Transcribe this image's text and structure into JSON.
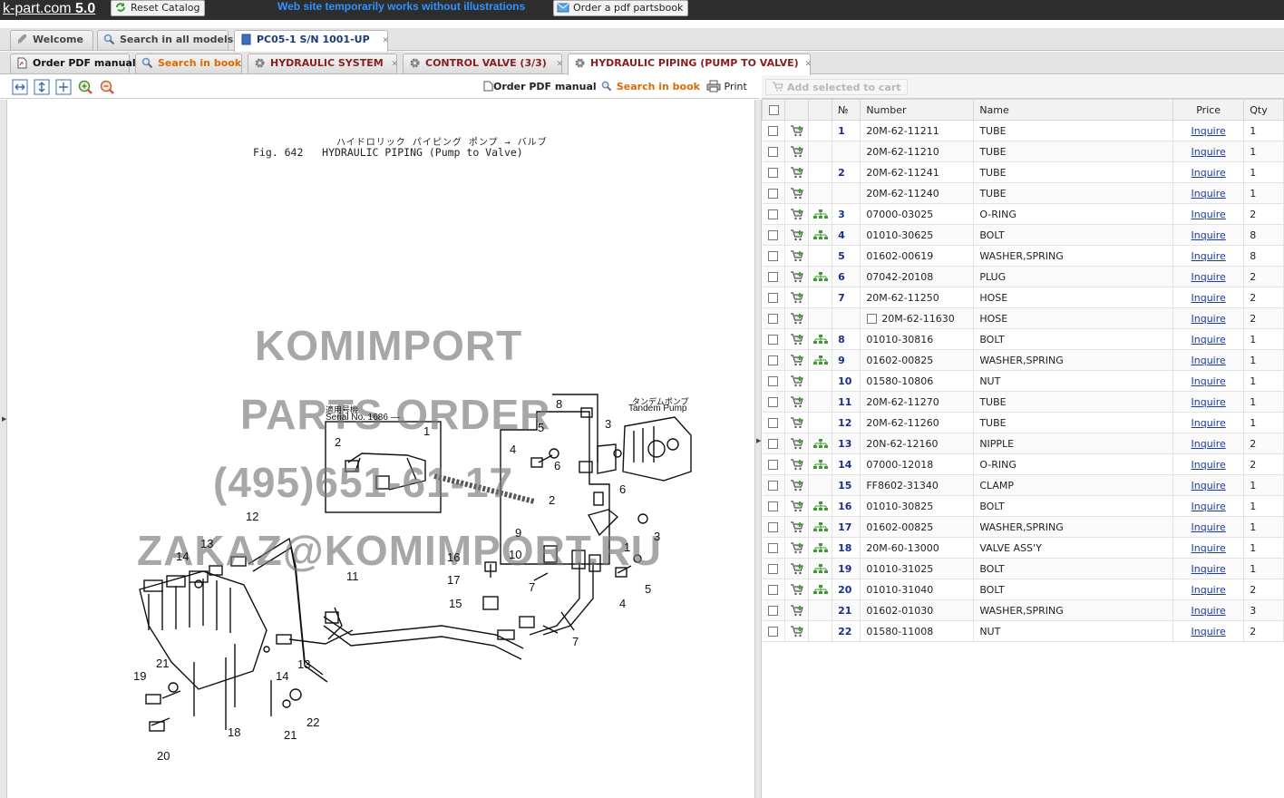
{
  "header": {
    "brand": "k-part.com",
    "version": "5.0",
    "reset_label": "Reset Catalog",
    "notice": "Web site temporarily works without illustrations",
    "order_partsbook_label": "Order a pdf partsbook"
  },
  "tabs_row1": [
    {
      "label": "Welcome",
      "icon": "rocket-icon"
    },
    {
      "label": "Search in all models",
      "icon": "search-icon"
    },
    {
      "label": "PC05-1 S/N 1001-UP",
      "icon": "book-icon",
      "active": true
    }
  ],
  "tabs_row2": [
    {
      "label": "Order PDF manual",
      "icon": "pdf-icon"
    },
    {
      "label": "Search in book",
      "icon": "search-icon"
    },
    {
      "label": "HYDRAULIC SYSTEM",
      "icon": "gear-icon"
    },
    {
      "label": "CONTROL VALVE (3/3)",
      "icon": "gear-icon"
    },
    {
      "label": "HYDRAULIC PIPING (PUMP TO VALVE)",
      "icon": "gear-icon",
      "active": true
    }
  ],
  "toolbar": {
    "order_pdf": "Order PDF manual",
    "search_in_book": "Search in book",
    "print": "Print",
    "add_to_cart": "Add selected to cart"
  },
  "figure": {
    "title_jp": "ハイドロリック パイピング ポンプ → バルブ",
    "title_en": "Fig. 642   HYDRAULIC PIPING (Pump to Valve)",
    "serial_jp": "適用号機",
    "serial_label": "Serial No. 1686 —",
    "pump_jp": "タンデムポンプ",
    "pump_label": "Tandem Pump",
    "watermark": [
      "KOMIMPORT",
      "PARTS ORDER",
      "(495)651-61-17",
      "ZAKAZ@KOMIMPORT.RU"
    ]
  },
  "table": {
    "headers": [
      "№",
      "Number",
      "Name",
      "Price",
      "Qty"
    ],
    "rows": [
      {
        "no": "1",
        "number": "20M-62-11211",
        "name": "TUBE",
        "price": "Inquire",
        "qty": "1",
        "tree": false
      },
      {
        "no": "",
        "number": "20M-62-11210",
        "name": "TUBE",
        "price": "Inquire",
        "qty": "1",
        "tree": false
      },
      {
        "no": "2",
        "number": "20M-62-11241",
        "name": "TUBE",
        "price": "Inquire",
        "qty": "1",
        "tree": false
      },
      {
        "no": "",
        "number": "20M-62-11240",
        "name": "TUBE",
        "price": "Inquire",
        "qty": "1",
        "tree": false
      },
      {
        "no": "3",
        "number": "07000-03025",
        "name": "O-RING",
        "price": "Inquire",
        "qty": "2",
        "tree": true
      },
      {
        "no": "4",
        "number": "01010-30625",
        "name": "BOLT",
        "price": "Inquire",
        "qty": "8",
        "tree": true
      },
      {
        "no": "5",
        "number": "01602-00619",
        "name": "WASHER,SPRING",
        "price": "Inquire",
        "qty": "8",
        "tree": false
      },
      {
        "no": "6",
        "number": "07042-20108",
        "name": "PLUG",
        "price": "Inquire",
        "qty": "2",
        "tree": true
      },
      {
        "no": "7",
        "number": "20M-62-11250",
        "name": "HOSE",
        "price": "Inquire",
        "qty": "2",
        "tree": false
      },
      {
        "no": "",
        "number": "20M-62-11630",
        "name": "HOSE",
        "price": "Inquire",
        "qty": "2",
        "tree": false,
        "box": true
      },
      {
        "no": "8",
        "number": "01010-30816",
        "name": "BOLT",
        "price": "Inquire",
        "qty": "1",
        "tree": true
      },
      {
        "no": "9",
        "number": "01602-00825",
        "name": "WASHER,SPRING",
        "price": "Inquire",
        "qty": "1",
        "tree": true
      },
      {
        "no": "10",
        "number": "01580-10806",
        "name": "NUT",
        "price": "Inquire",
        "qty": "1",
        "tree": false
      },
      {
        "no": "11",
        "number": "20M-62-11270",
        "name": "TUBE",
        "price": "Inquire",
        "qty": "1",
        "tree": false
      },
      {
        "no": "12",
        "number": "20M-62-11260",
        "name": "TUBE",
        "price": "Inquire",
        "qty": "1",
        "tree": false
      },
      {
        "no": "13",
        "number": "20N-62-12160",
        "name": "NIPPLE",
        "price": "Inquire",
        "qty": "2",
        "tree": true
      },
      {
        "no": "14",
        "number": "07000-12018",
        "name": "O-RING",
        "price": "Inquire",
        "qty": "2",
        "tree": true
      },
      {
        "no": "15",
        "number": "FF8602-31340",
        "name": "CLAMP",
        "price": "Inquire",
        "qty": "1",
        "tree": false
      },
      {
        "no": "16",
        "number": "01010-30825",
        "name": "BOLT",
        "price": "Inquire",
        "qty": "1",
        "tree": true
      },
      {
        "no": "17",
        "number": "01602-00825",
        "name": "WASHER,SPRING",
        "price": "Inquire",
        "qty": "1",
        "tree": true
      },
      {
        "no": "18",
        "number": "20M-60-13000",
        "name": "VALVE ASS'Y",
        "price": "Inquire",
        "qty": "1",
        "tree": true
      },
      {
        "no": "19",
        "number": "01010-31025",
        "name": "BOLT",
        "price": "Inquire",
        "qty": "1",
        "tree": true
      },
      {
        "no": "20",
        "number": "01010-31040",
        "name": "BOLT",
        "price": "Inquire",
        "qty": "2",
        "tree": true
      },
      {
        "no": "21",
        "number": "01602-01030",
        "name": "WASHER,SPRING",
        "price": "Inquire",
        "qty": "3",
        "tree": false
      },
      {
        "no": "22",
        "number": "01580-11008",
        "name": "NUT",
        "price": "Inquire",
        "qty": "2",
        "tree": false
      }
    ]
  }
}
